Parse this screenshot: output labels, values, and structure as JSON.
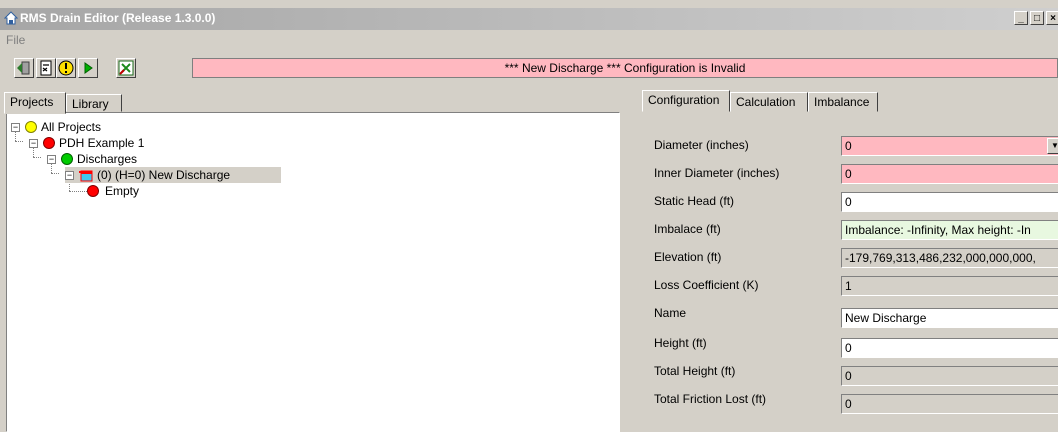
{
  "window": {
    "title": "RMS Drain Editor (Release 1.3.0.0)",
    "controls": [
      "_",
      "□",
      "×"
    ]
  },
  "menu": {
    "file_label": "File"
  },
  "toolbar": {
    "icons": [
      "exit-icon",
      "calculator-icon",
      "warning-icon",
      "play-icon",
      "excel-icon"
    ],
    "status_text": "*** New Discharge ***   Configuration is Invalid",
    "status_color": "#ffb8c0"
  },
  "left_tabs": [
    "Projects",
    "Library"
  ],
  "tree": {
    "root": "All Projects",
    "project": "PDH Example 1",
    "discharges": "Discharges",
    "discharge_item": "(0) (H=0) New Discharge",
    "child": "Empty"
  },
  "right_tabs": [
    "Configuration",
    "Calculation",
    "Imbalance"
  ],
  "form": {
    "fields": [
      {
        "label": "Diameter (inches)",
        "value": "0"
      },
      {
        "label": "Inner Diameter (inches)",
        "value": "0"
      },
      {
        "label": "Static Head (ft)",
        "value": "0"
      },
      {
        "label": "Imbalace (ft)",
        "value": "Imbalance: -Infinity,    Max height: -In"
      },
      {
        "label": "Elevation (ft)",
        "value": "-179,769,313,486,232,000,000,000,"
      },
      {
        "label": "Loss Coefficient (K)",
        "value": "1"
      },
      {
        "label": "Name",
        "value": "New Discharge"
      },
      {
        "label": "Height (ft)",
        "value": "0"
      },
      {
        "label": "Total Height (ft)",
        "value": "0"
      },
      {
        "label": "Total Friction Lost (ft)",
        "value": "0"
      }
    ]
  },
  "colors": {
    "invalid": "#ffb8c0",
    "valid": "#e8f8e0",
    "dot_red": "#ff0000",
    "dot_green": "#00cc00",
    "dot_yellow": "#ffff00"
  }
}
